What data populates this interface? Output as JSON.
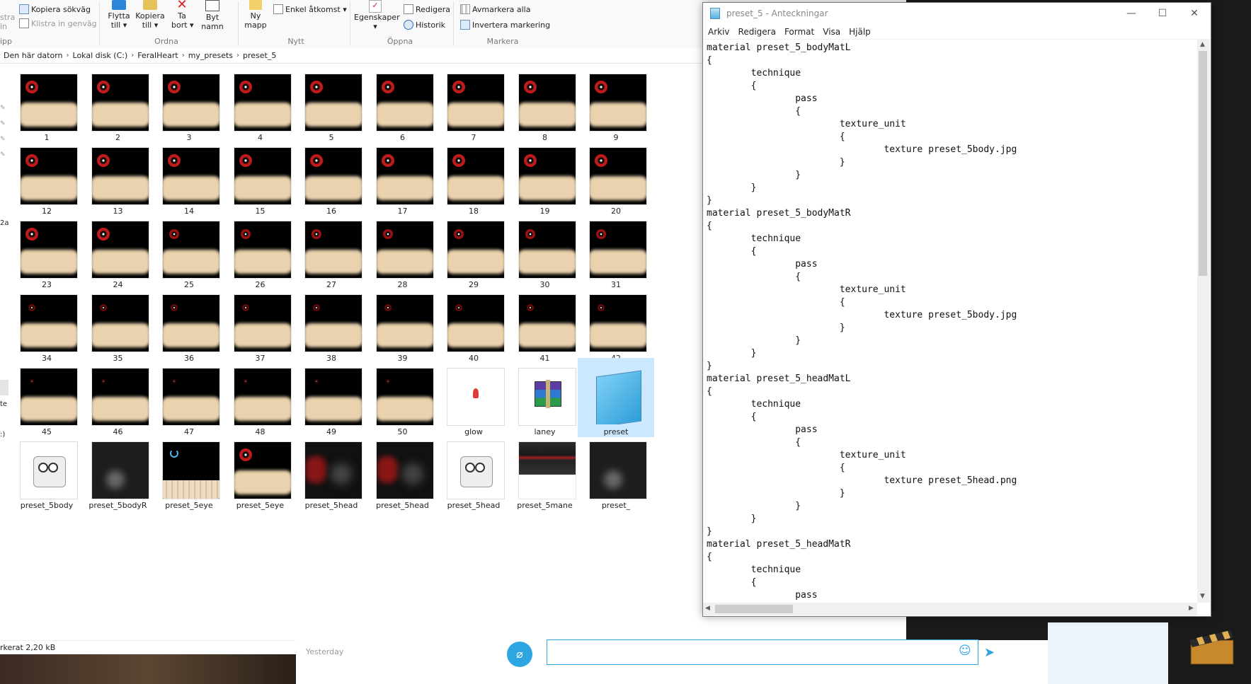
{
  "explorer": {
    "ribbon": {
      "paste_partial": "stra",
      "paste_partial2": "in",
      "clipboard_group": "ipp",
      "copy_path": "Kopiera sökväg",
      "paste_shortcut": "Klistra in genväg",
      "move_to": "Flytta\ntill ▾",
      "copy_to": "Kopiera\ntill ▾",
      "delete": "Ta\nbort ▾",
      "rename": "Byt\nnamn",
      "organize_group": "Ordna",
      "new_folder": "Ny\nmapp",
      "easy_access": "Enkel åtkomst ▾",
      "new_group": "Nytt",
      "properties": "Egenskaper\n▾",
      "edit": "Redigera",
      "history": "Historik",
      "open_group": "Öppna",
      "select_none": "Avmarkera alla",
      "invert_selection": "Invertera markering",
      "select_group": "Markera"
    },
    "breadcrumb": [
      "Den här datorn",
      "Lokal disk (C:)",
      "FeralHeart",
      "my_presets",
      "preset_5"
    ],
    "nav_fragments": [
      "2a",
      "te",
      ":)"
    ],
    "files": [
      {
        "name": "1",
        "kind": "eye",
        "glow": 3
      },
      {
        "name": "2",
        "kind": "eye",
        "glow": 3
      },
      {
        "name": "3",
        "kind": "eye",
        "glow": 3
      },
      {
        "name": "4",
        "kind": "eye",
        "glow": 3
      },
      {
        "name": "5",
        "kind": "eye",
        "glow": 3
      },
      {
        "name": "6",
        "kind": "eye",
        "glow": 3
      },
      {
        "name": "7",
        "kind": "eye",
        "glow": 3
      },
      {
        "name": "8",
        "kind": "eye",
        "glow": 3
      },
      {
        "name": "9",
        "kind": "eye",
        "glow": 3
      },
      {
        "name": "12",
        "kind": "eye",
        "glow": 3
      },
      {
        "name": "13",
        "kind": "eye",
        "glow": 3
      },
      {
        "name": "14",
        "kind": "eye",
        "glow": 3
      },
      {
        "name": "15",
        "kind": "eye",
        "glow": 3
      },
      {
        "name": "16",
        "kind": "eye",
        "glow": 3
      },
      {
        "name": "17",
        "kind": "eye",
        "glow": 3
      },
      {
        "name": "18",
        "kind": "eye",
        "glow": 3
      },
      {
        "name": "19",
        "kind": "eye",
        "glow": 3
      },
      {
        "name": "20",
        "kind": "eye",
        "glow": 3
      },
      {
        "name": "23",
        "kind": "eye",
        "glow": 3
      },
      {
        "name": "24",
        "kind": "eye",
        "glow": 3
      },
      {
        "name": "25",
        "kind": "eye",
        "glow": 2
      },
      {
        "name": "26",
        "kind": "eye",
        "glow": 2
      },
      {
        "name": "27",
        "kind": "eye",
        "glow": 2
      },
      {
        "name": "28",
        "kind": "eye",
        "glow": 2
      },
      {
        "name": "29",
        "kind": "eye",
        "glow": 2
      },
      {
        "name": "30",
        "kind": "eye",
        "glow": 2
      },
      {
        "name": "31",
        "kind": "eye",
        "glow": 2
      },
      {
        "name": "34",
        "kind": "eye",
        "glow": 1
      },
      {
        "name": "35",
        "kind": "eye",
        "glow": 1
      },
      {
        "name": "36",
        "kind": "eye",
        "glow": 1
      },
      {
        "name": "37",
        "kind": "eye",
        "glow": 1
      },
      {
        "name": "38",
        "kind": "eye",
        "glow": 1
      },
      {
        "name": "39",
        "kind": "eye",
        "glow": 1
      },
      {
        "name": "40",
        "kind": "eye",
        "glow": 1
      },
      {
        "name": "41",
        "kind": "eye",
        "glow": 1
      },
      {
        "name": "42",
        "kind": "eye",
        "glow": 1
      },
      {
        "name": "45",
        "kind": "eye",
        "glow": 0
      },
      {
        "name": "46",
        "kind": "eye",
        "glow": 0
      },
      {
        "name": "47",
        "kind": "eye",
        "glow": 0
      },
      {
        "name": "48",
        "kind": "eye",
        "glow": 0
      },
      {
        "name": "49",
        "kind": "eye",
        "glow": 0
      },
      {
        "name": "50",
        "kind": "eye",
        "glow": 0
      },
      {
        "name": "glow",
        "kind": "glow"
      },
      {
        "name": "laney",
        "kind": "rar"
      },
      {
        "name": "preset",
        "kind": "notepad",
        "selected": true
      },
      {
        "name": "preset_5body",
        "kind": "gimp"
      },
      {
        "name": "preset_5bodyR",
        "kind": "grey"
      },
      {
        "name": "preset_5eye",
        "kind": "teeth"
      },
      {
        "name": "preset_5eye",
        "kind": "eye",
        "glow": 3
      },
      {
        "name": "preset_5head",
        "kind": "reddish"
      },
      {
        "name": "preset_5head",
        "kind": "reddish"
      },
      {
        "name": "preset_5head",
        "kind": "gimp"
      },
      {
        "name": "preset_5mane",
        "kind": "mane"
      },
      {
        "name": "preset_",
        "kind": "grey"
      }
    ],
    "status": "rkerat  2,20 kB"
  },
  "notepad": {
    "title": "preset_5 - Anteckningar",
    "menu": [
      "Arkiv",
      "Redigera",
      "Format",
      "Visa",
      "Hjälp"
    ],
    "text": "material preset_5_bodyMatL\n{\n\ttechnique\n\t{\n\t\tpass\n\t\t{\n\t\t\ttexture_unit\n\t\t\t{\n\t\t\t\ttexture preset_5body.jpg\n\t\t\t}\n\t\t}\n\t}\n}\nmaterial preset_5_bodyMatR\n{\n\ttechnique\n\t{\n\t\tpass\n\t\t{\n\t\t\ttexture_unit\n\t\t\t{\n\t\t\t\ttexture preset_5body.jpg\n\t\t\t}\n\t\t}\n\t}\n}\nmaterial preset_5_headMatL\n{\n\ttechnique\n\t{\n\t\tpass\n\t\t{\n\t\t\ttexture_unit\n\t\t\t{\n\t\t\t\ttexture preset_5head.png\n\t\t\t}\n\t\t}\n\t}\n}\nmaterial preset_5_headMatR\n{\n\ttechnique\n\t{\n\t\tpass"
  },
  "background": {
    "chat_day": "Yesterday"
  },
  "colors": {
    "accent": "#2ca5e0",
    "selection": "#cce8ff",
    "eye_red": "#c21a1a"
  }
}
